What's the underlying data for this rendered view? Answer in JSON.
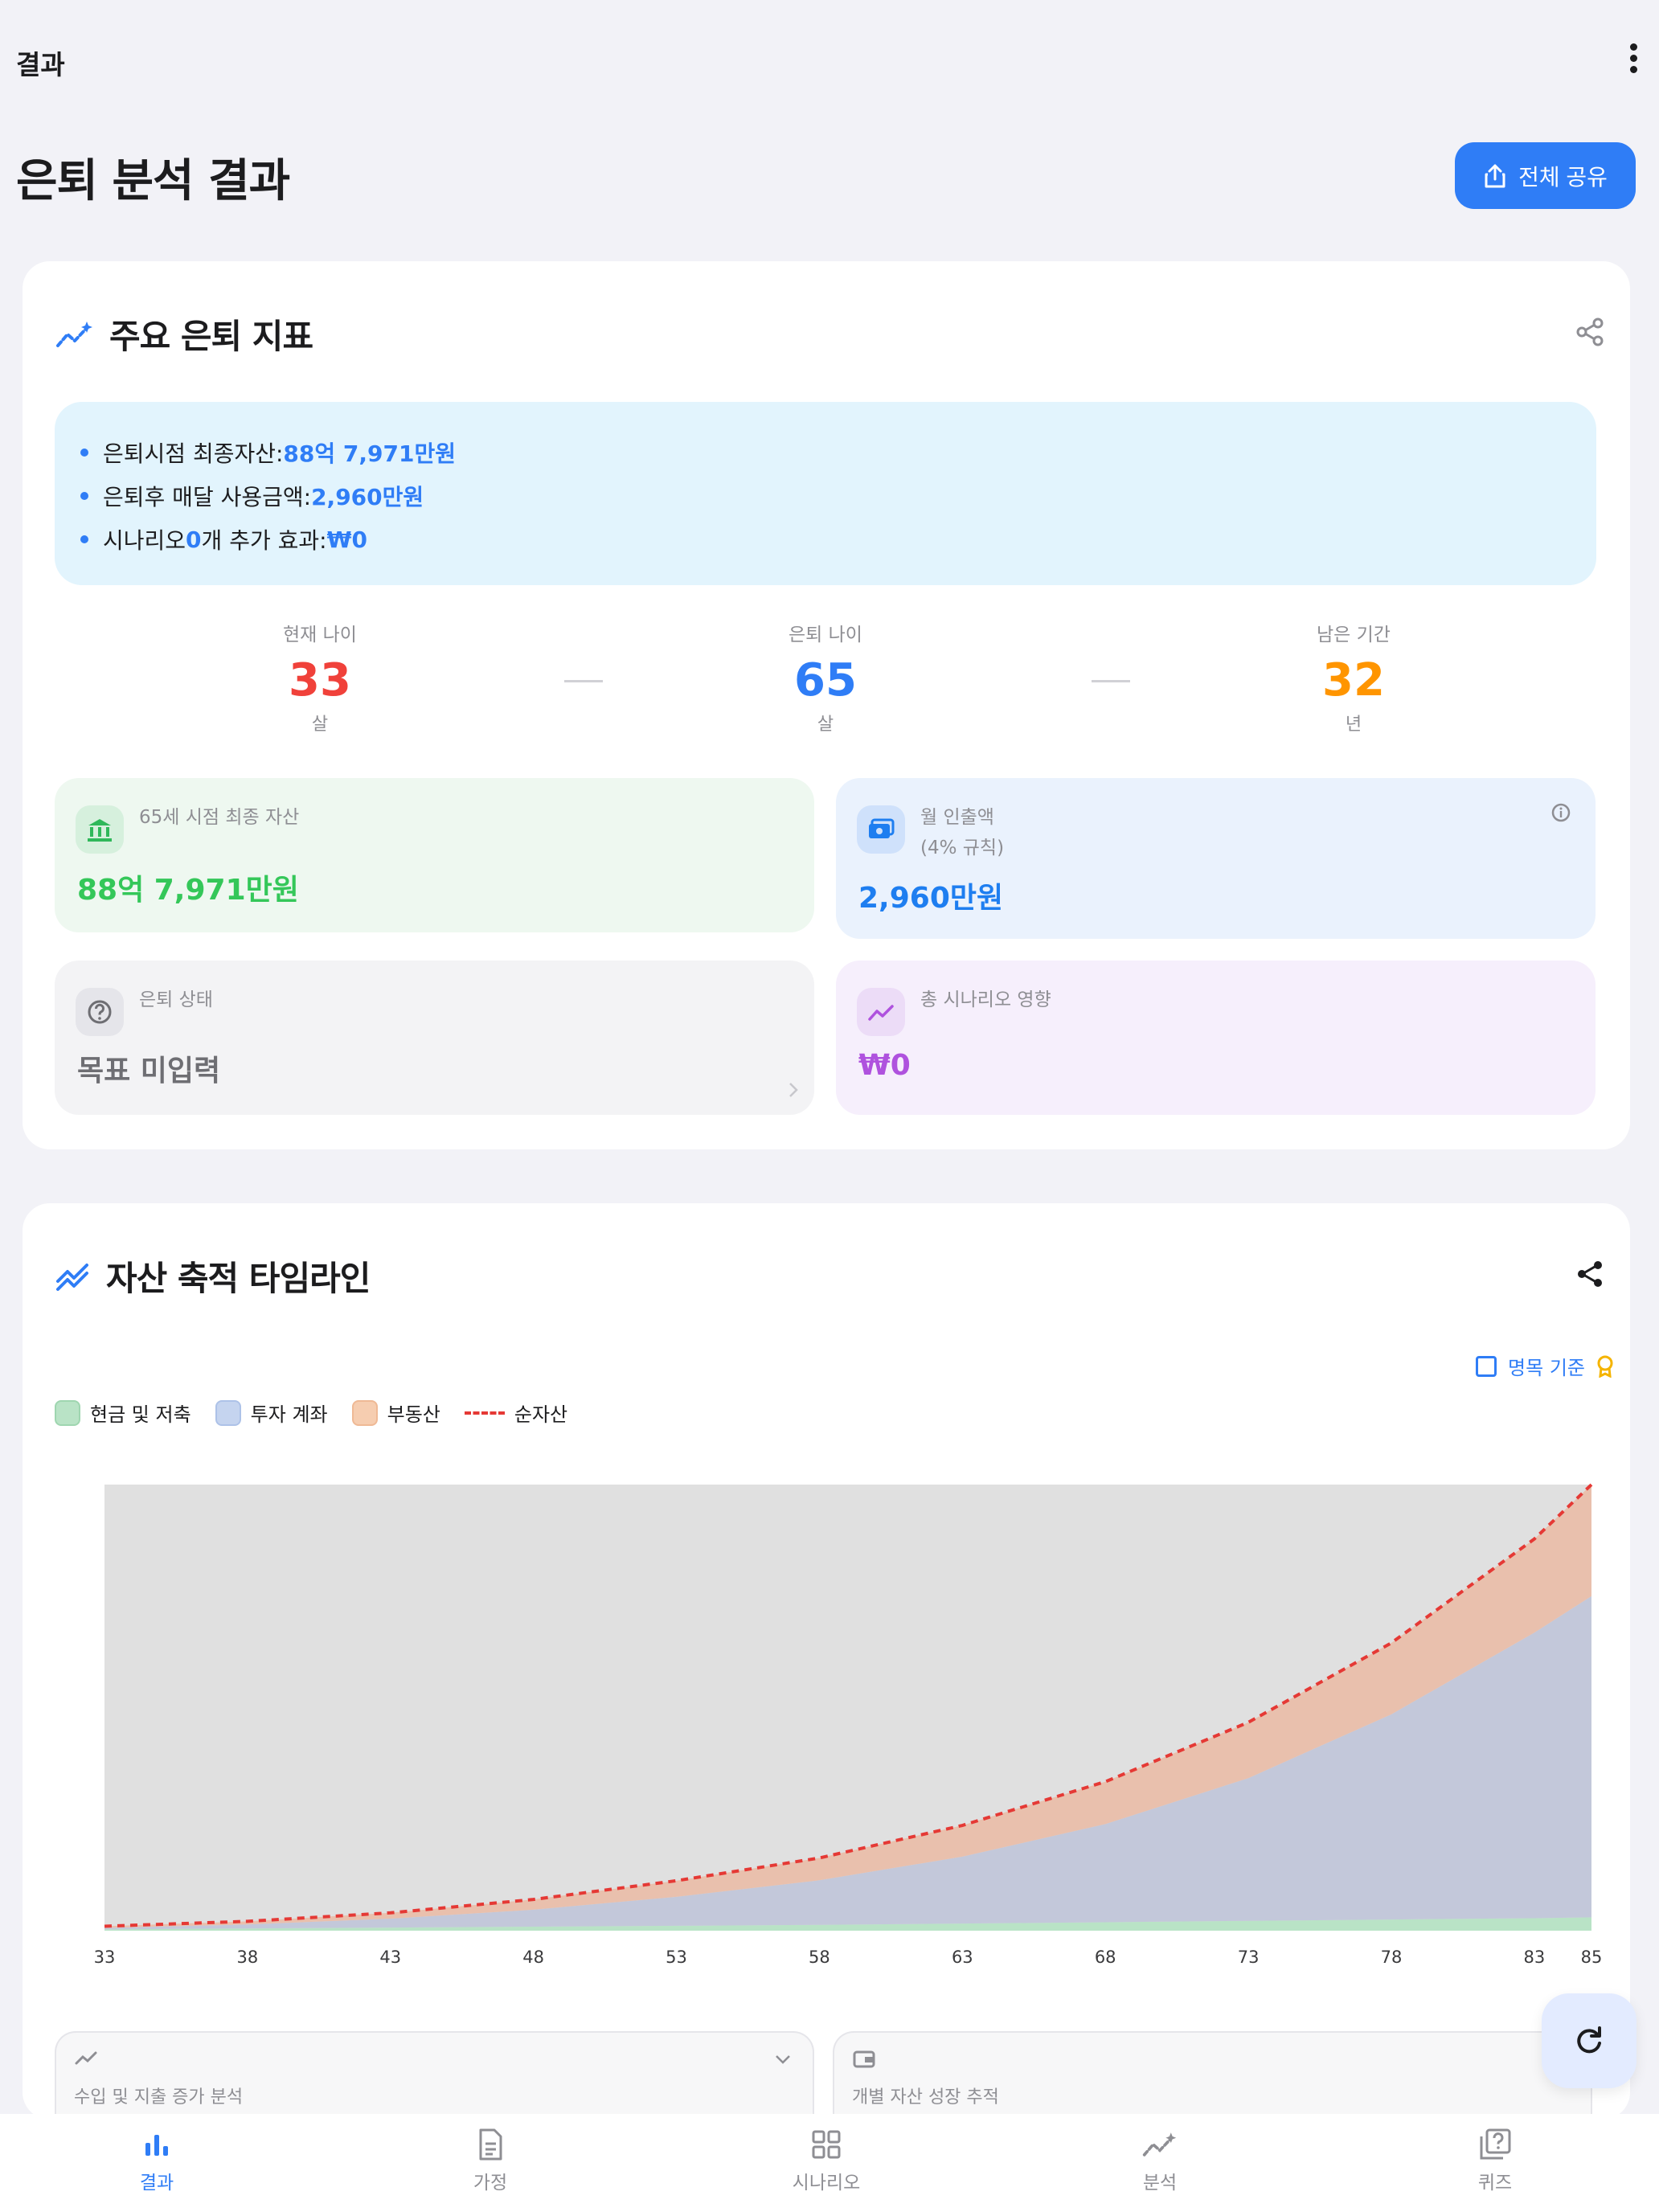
{
  "header": {
    "title": "결과"
  },
  "page": {
    "title": "은퇴 분석 결과",
    "share_all_label": "전체 공유"
  },
  "indicators": {
    "title": "주요 은퇴 지표",
    "summary": [
      {
        "prefix": "은퇴시점 최종자산: ",
        "value": "88억 7,971만원",
        "suffix": ""
      },
      {
        "prefix": "은퇴후 매달 사용금액: ",
        "value": "2,960만원",
        "suffix": ""
      },
      {
        "prefix": "시나리오 ",
        "value": "0",
        "suffix": "개 추가 효과: ",
        "value2": "₩0"
      }
    ],
    "ages": [
      {
        "label": "현재 나이",
        "value": "33",
        "unit": "살",
        "color": "#f0413a"
      },
      {
        "label": "은퇴 나이",
        "value": "65",
        "unit": "살",
        "color": "#2f7df6"
      },
      {
        "label": "남은 기간",
        "value": "32",
        "unit": "년",
        "color": "#ff9500"
      }
    ],
    "tiles": {
      "final_asset": {
        "label": "65세 시점 최종 자산",
        "value": "88억 7,971만원",
        "color": "#34c759"
      },
      "monthly": {
        "label_line1": "월 인출액",
        "label_line2": "(4% 규칙)",
        "value": "2,960만원",
        "color": "#1e7ef0"
      },
      "status": {
        "label": "은퇴 상태",
        "value": "목표 미입력",
        "color": "#6e6e73"
      },
      "scenario": {
        "label": "총 시나리오 영향",
        "value": "₩0",
        "color": "#af52de"
      }
    }
  },
  "timeline": {
    "title": "자산 축적 타임라인",
    "nominal_toggle": {
      "label": "명목 기준",
      "checked": false
    },
    "legend": [
      {
        "label": "현금 및 저축",
        "color": "#b9e3c6"
      },
      {
        "label": "투자 계좌",
        "color": "#c5d4ef"
      },
      {
        "label": "부동산",
        "color": "#f6cdb0"
      },
      {
        "label": "순자산",
        "color": "#e53935"
      }
    ],
    "accordions": [
      {
        "label": "수입 및 지출 증가 분석",
        "icon": "trend-icon"
      },
      {
        "label": "개별 자산 성장 추적",
        "icon": "wallet-icon"
      }
    ]
  },
  "chart_data": {
    "type": "area",
    "x": [
      33,
      38,
      43,
      48,
      53,
      58,
      63,
      68,
      73,
      78,
      83,
      85
    ],
    "xticks": [
      "33",
      "38",
      "43",
      "48",
      "53",
      "58",
      "63",
      "68",
      "73",
      "78",
      "83",
      "85"
    ],
    "series": [
      {
        "name": "현금 및 저축",
        "values": [
          0.3,
          0.5,
          0.7,
          0.9,
          1.1,
          1.3,
          1.6,
          1.9,
          2.2,
          2.5,
          2.8,
          3
        ]
      },
      {
        "name": "투자 계좌",
        "values": [
          0.3,
          0.9,
          2,
          3.8,
          6.5,
          10,
          15,
          22,
          32,
          46,
          64,
          72
        ]
      },
      {
        "name": "부동산",
        "values": [
          0.4,
          0.7,
          1.3,
          2.3,
          3.6,
          5,
          7,
          9.5,
          12.5,
          16,
          21,
          25
        ]
      },
      {
        "name": "순자산",
        "values": [
          1,
          2.1,
          4,
          7,
          11.2,
          16.3,
          23.6,
          33.4,
          46.7,
          64.5,
          87.8,
          100
        ]
      }
    ],
    "stacked": true,
    "ylim": [
      0,
      100
    ],
    "grid": false
  },
  "tabbar": {
    "items": [
      {
        "label": "결과",
        "icon": "bar-chart-icon",
        "active": true
      },
      {
        "label": "가정",
        "icon": "document-icon",
        "active": false
      },
      {
        "label": "시나리오",
        "icon": "grid-icon",
        "active": false
      },
      {
        "label": "분석",
        "icon": "sparkle-trend-icon",
        "active": false
      },
      {
        "label": "퀴즈",
        "icon": "quiz-icon",
        "active": false
      }
    ]
  }
}
